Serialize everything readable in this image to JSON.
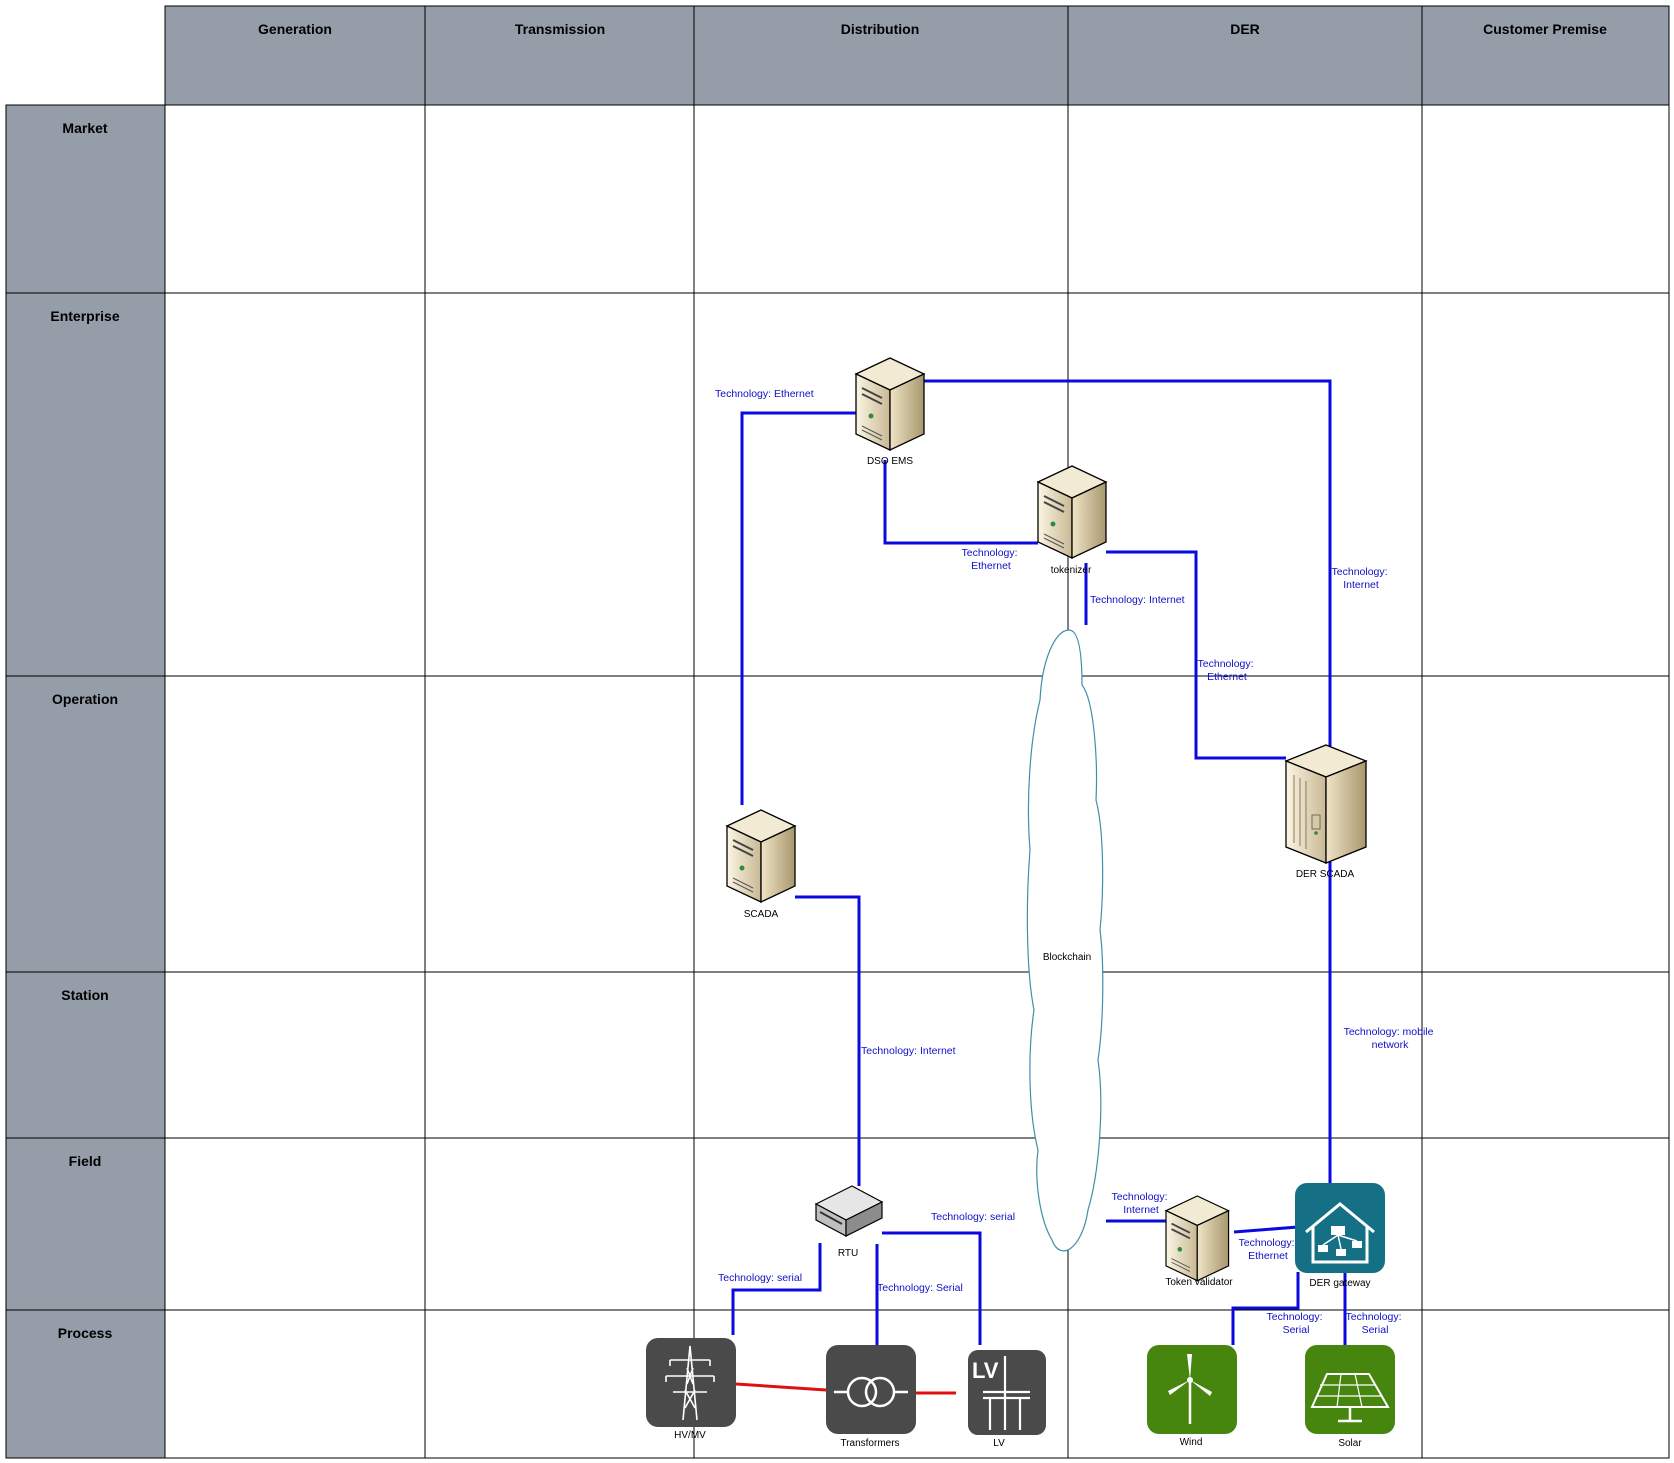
{
  "columns": [
    "Generation",
    "Transmission",
    "Distribution",
    "DER",
    "Customer Premise"
  ],
  "rows": [
    "Market",
    "Enterprise",
    "Operation",
    "Station",
    "Field",
    "Process"
  ],
  "nodes": {
    "dso_ems": "DSO EMS",
    "tokenizer": "tokenizer",
    "der_scada": "DER SCADA",
    "scada": "SCADA",
    "blockchain": "Blockchain",
    "rtu": "RTU",
    "token_validator": "Token validator",
    "der_gateway": "DER gateway",
    "hv_mv": "HV/MV",
    "transformers": "Transformers",
    "lv": "LV",
    "lv_icon_text": "LV",
    "wind": "Wind",
    "solar": "Solar"
  },
  "links": {
    "ems_scada": "Technology: Ethernet",
    "ems_tokenizer": [
      "Technology:",
      "Ethernet"
    ],
    "tokenizer_blockchain": "Technology: Internet",
    "tokenizer_derscada": [
      "Technology:",
      "Ethernet"
    ],
    "ems_derscada": [
      "Technology:",
      "Internet"
    ],
    "scada_rtu": "Technology: Internet",
    "derscada_gateway": [
      "Technology: mobile",
      "network"
    ],
    "rtu_hvmv": "Technology: serial",
    "rtu_lv": "Technology: serial",
    "rtu_transformers": "Technology: Serial",
    "blockchain_validator": [
      "Technology:",
      "Internet"
    ],
    "validator_gateway": [
      "Technology:",
      "Ethernet"
    ],
    "gateway_wind": [
      "Technology:",
      "Serial"
    ],
    "gateway_solar": [
      "Technology:",
      "Serial"
    ]
  },
  "colors": {
    "header_fill": "#959da8",
    "link": "#0a0ae0",
    "power_link": "#e01010",
    "grid_icon": "#4a4a4a",
    "gateway_icon": "#157086",
    "renewable_icon": "#46860e",
    "technology_text": "#1010c8"
  }
}
